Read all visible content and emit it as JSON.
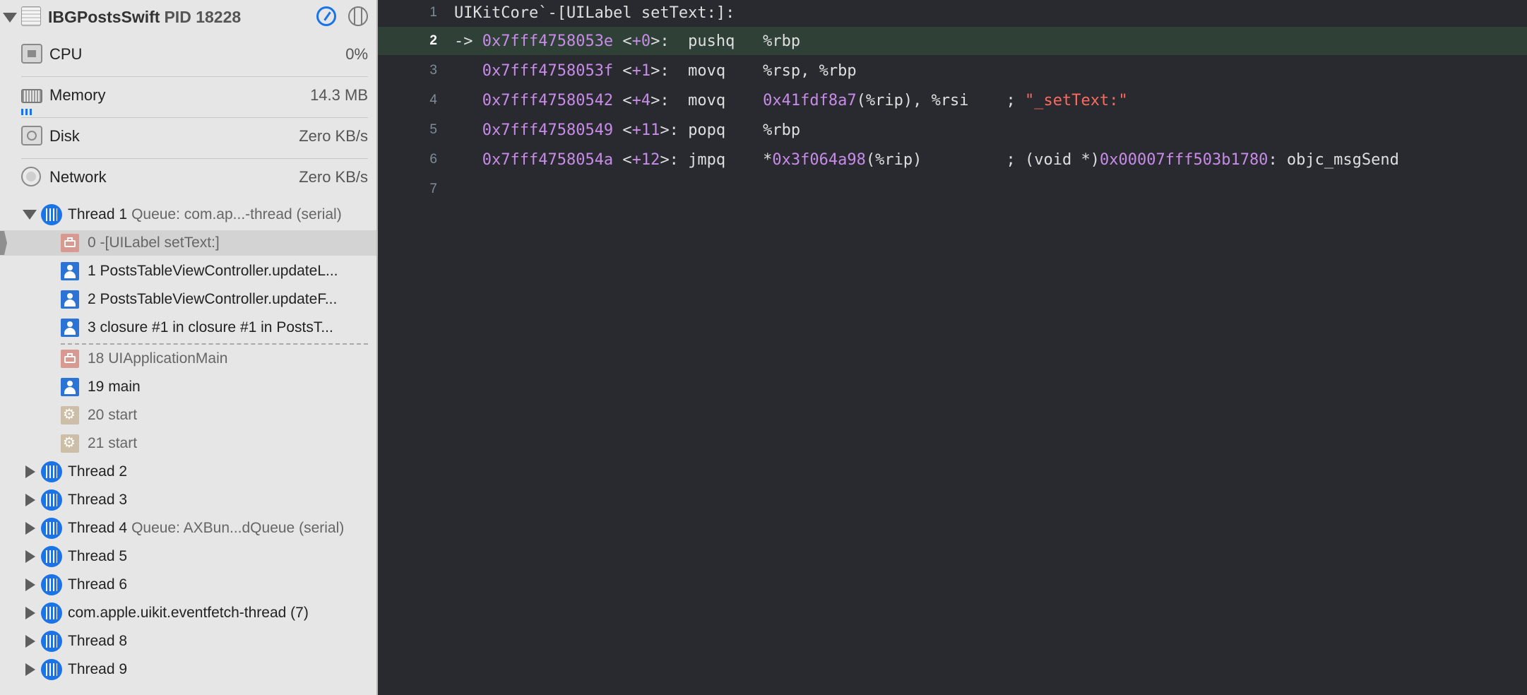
{
  "process": {
    "name": "IBGPostsSwift",
    "pid_label": "PID 18228"
  },
  "gauges": [
    {
      "id": "cpu",
      "label": "CPU",
      "value": "0%"
    },
    {
      "id": "memory",
      "label": "Memory",
      "value": "14.3 MB"
    },
    {
      "id": "disk",
      "label": "Disk",
      "value": "Zero KB/s"
    },
    {
      "id": "network",
      "label": "Network",
      "value": "Zero KB/s"
    }
  ],
  "thread1": {
    "label": "Thread 1",
    "queue": "Queue: com.ap...-thread (serial)",
    "frames": [
      {
        "label": "0 -[UILabel setText:]",
        "icon": "library-icon"
      },
      {
        "label": "1 PostsTableViewController.updateL...",
        "icon": "user-icon"
      },
      {
        "label": "2 PostsTableViewController.updateF...",
        "icon": "user-icon"
      },
      {
        "label": "3 closure #1 in closure #1 in PostsT...",
        "icon": "user-icon"
      },
      {
        "label": "18 UIApplicationMain",
        "icon": "library-icon"
      },
      {
        "label": "19 main",
        "icon": "user-icon"
      },
      {
        "label": "20 start",
        "icon": "system-gear-icon"
      },
      {
        "label": "21 start",
        "icon": "system-gear-icon"
      }
    ]
  },
  "threads": [
    {
      "label": "Thread 2",
      "queue": ""
    },
    {
      "label": "Thread 3",
      "queue": ""
    },
    {
      "label": "Thread 4",
      "queue": "Queue: AXBun...dQueue (serial)"
    },
    {
      "label": "Thread 5",
      "queue": ""
    },
    {
      "label": "Thread 6",
      "queue": ""
    },
    {
      "label": "com.apple.uikit.eventfetch-thread (7)",
      "queue": ""
    },
    {
      "label": "Thread 8",
      "queue": ""
    },
    {
      "label": "Thread 9",
      "queue": ""
    }
  ],
  "disassembly": {
    "lines": [
      {
        "num": "1",
        "text": "UIKitCore`-[UILabel setText:]:"
      },
      {
        "num": "2",
        "arrow": "-> ",
        "addr": "0x7fff4758053e",
        "off": "+0",
        "mnemonic": "pushq ",
        "operands": "%rbp",
        "current": true
      },
      {
        "num": "3",
        "arrow": "   ",
        "addr": "0x7fff4758053f",
        "off": "+1",
        "mnemonic": "movq  ",
        "operands": "%rsp, %rbp"
      },
      {
        "num": "4",
        "arrow": "   ",
        "addr": "0x7fff47580542",
        "off": "+4",
        "mnemonic": "movq  ",
        "op_num": "0x41fdf8a7",
        "operands": "(%rip), %rsi    ; ",
        "str": "\"_setText:\""
      },
      {
        "num": "5",
        "arrow": "   ",
        "addr": "0x7fff47580549",
        "off": "+11",
        "mnemonic": "popq  ",
        "operands": "%rbp"
      },
      {
        "num": "6",
        "arrow": "   ",
        "addr": "0x7fff4758054a",
        "off": "+12",
        "mnemonic": "jmpq  ",
        "pre": "*",
        "op_num": "0x3f064a98",
        "operands": "(%rip)         ; (void *)",
        "target": "0x00007fff503b1780",
        "suffix": ": objc_msgSend"
      },
      {
        "num": "7"
      }
    ]
  },
  "colors": {
    "current_line": "#2f4037",
    "address": "#c88ce8",
    "string": "#fc6a5d",
    "thread_icon": "#1a73e8"
  }
}
